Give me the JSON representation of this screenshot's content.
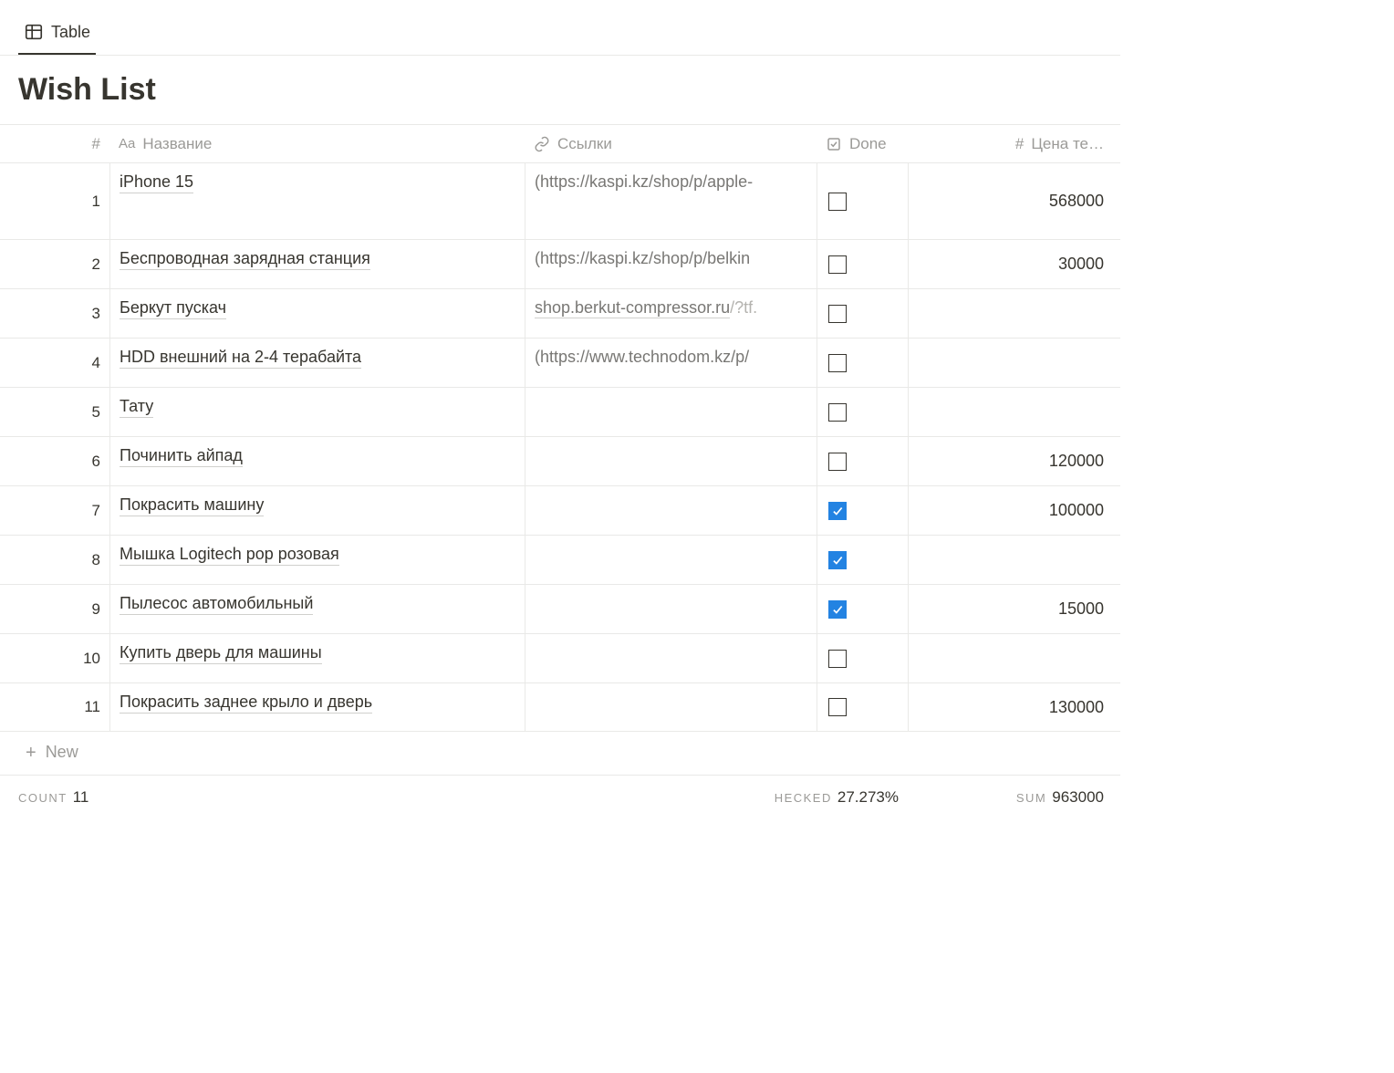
{
  "view_tab": "Table",
  "title": "Wish List",
  "columns": {
    "index": "#",
    "name": "Название",
    "name_prefix": "Aa",
    "link": "Ссылки",
    "done": "Done",
    "price": "Цена те…"
  },
  "rows": [
    {
      "idx": "1",
      "name": "iPhone 15",
      "link_plain": "(https://kaspi.kz/shop/p/apple-",
      "done": false,
      "price": "568000"
    },
    {
      "idx": "2",
      "name": "Беспроводная зарядная станция",
      "link_plain": "(https://kaspi.kz/shop/p/belkin",
      "done": false,
      "price": "30000"
    },
    {
      "idx": "3",
      "name": "Беркут пускач",
      "link_underlined": "shop.berkut-compressor.ru",
      "link_gray": "/?tf.",
      "done": false,
      "price": ""
    },
    {
      "idx": "4",
      "name": "HDD внешний на 2-4 терабайта",
      "link_plain": "(https://www.technodom.kz/p/",
      "done": false,
      "price": ""
    },
    {
      "idx": "5",
      "name": "Тату",
      "done": false,
      "price": ""
    },
    {
      "idx": "6",
      "name": "Починить айпад",
      "done": false,
      "price": "120000"
    },
    {
      "idx": "7",
      "name": "Покрасить машину",
      "done": true,
      "price": "100000"
    },
    {
      "idx": "8",
      "name": "Мышка Logitech pop розовая",
      "done": true,
      "price": ""
    },
    {
      "idx": "9",
      "name": "Пылесос автомобильный",
      "done": true,
      "price": "15000"
    },
    {
      "idx": "10",
      "name": "Купить дверь для машины",
      "done": false,
      "price": ""
    },
    {
      "idx": "11",
      "name": "Покрасить заднее крыло и дверь",
      "done": false,
      "price": "130000"
    }
  ],
  "new_row_label": "New",
  "footer": {
    "count_label": "COUNT",
    "count_value": "11",
    "checked_label": "HECKED",
    "checked_value": "27.273%",
    "sum_label": "SUM",
    "sum_value": "963000"
  }
}
